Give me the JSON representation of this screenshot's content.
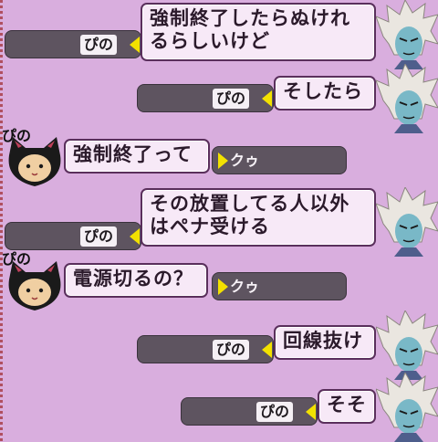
{
  "messages": [
    {
      "speaker": "ぴの",
      "text_lines": [
        "強制終了したらぬけれ",
        "るらしいけど"
      ],
      "side": "right"
    },
    {
      "speaker": "ぴの",
      "text_lines": [
        "そしたら"
      ],
      "side": "right"
    },
    {
      "speaker": "ぴの",
      "text_lines": [
        "強制終了って"
      ],
      "side": "left",
      "reply_to": "クゥ"
    },
    {
      "speaker": "ぴの",
      "text_lines": [
        "その放置してる人以外",
        "はペナ受ける"
      ],
      "side": "right"
    },
    {
      "speaker": "ぴの",
      "text_lines": [
        "電源切るの？"
      ],
      "side": "left",
      "reply_to": "クゥ"
    },
    {
      "speaker": "ぴの",
      "text_lines": [
        "回線抜け"
      ],
      "side": "right"
    },
    {
      "speaker": "ぴの",
      "text_lines": [
        "そそ"
      ],
      "side": "right"
    }
  ],
  "colors": {
    "background": "#d9aede",
    "bubble": "#f7e9f7",
    "tag": "#5e5460",
    "arrow": "#f2e100"
  },
  "icons": {
    "left_avatar": "black-cat-hood-avatar-icon",
    "right_avatar": "white-hair-blue-face-avatar-icon"
  }
}
